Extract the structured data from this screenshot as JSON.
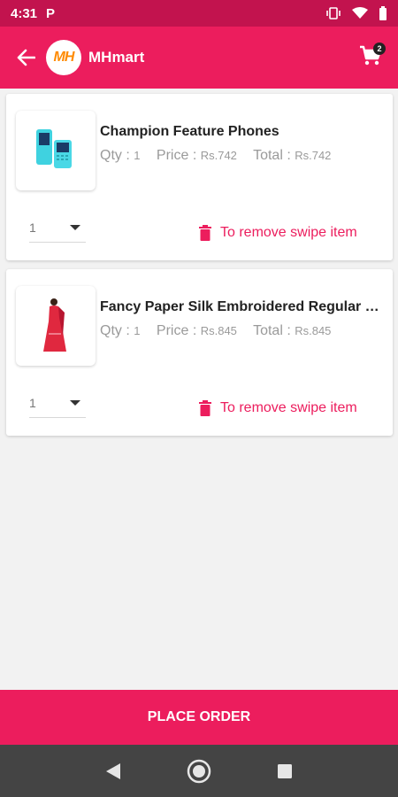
{
  "status_bar": {
    "time": "4:31",
    "app_indicator": "P",
    "icons": [
      "vibrate-icon",
      "wifi-icon",
      "battery-icon"
    ]
  },
  "app_bar": {
    "logo_text": "MH",
    "title": "MHmart",
    "cart_count": "2"
  },
  "items": [
    {
      "name": "Champion Feature Phones",
      "qty_label": "Qty :",
      "qty": "1",
      "price_label": "Price :",
      "price": "Rs.742",
      "total_label": "Total :",
      "total": "Rs.742",
      "selected_qty": "1",
      "remove_hint": "To remove swipe item"
    },
    {
      "name": "Fancy Paper Silk Embroidered Regular Saree",
      "qty_label": "Qty :",
      "qty": "1",
      "price_label": "Price :",
      "price": "Rs.845",
      "total_label": "Total :",
      "total": "Rs.845",
      "selected_qty": "1",
      "remove_hint": "To remove swipe item"
    }
  ],
  "footer": {
    "place_order_label": "PLACE ORDER"
  },
  "colors": {
    "primary": "#ec1d5d",
    "status_bar": "#c2134e",
    "nav_bar": "#444444"
  }
}
